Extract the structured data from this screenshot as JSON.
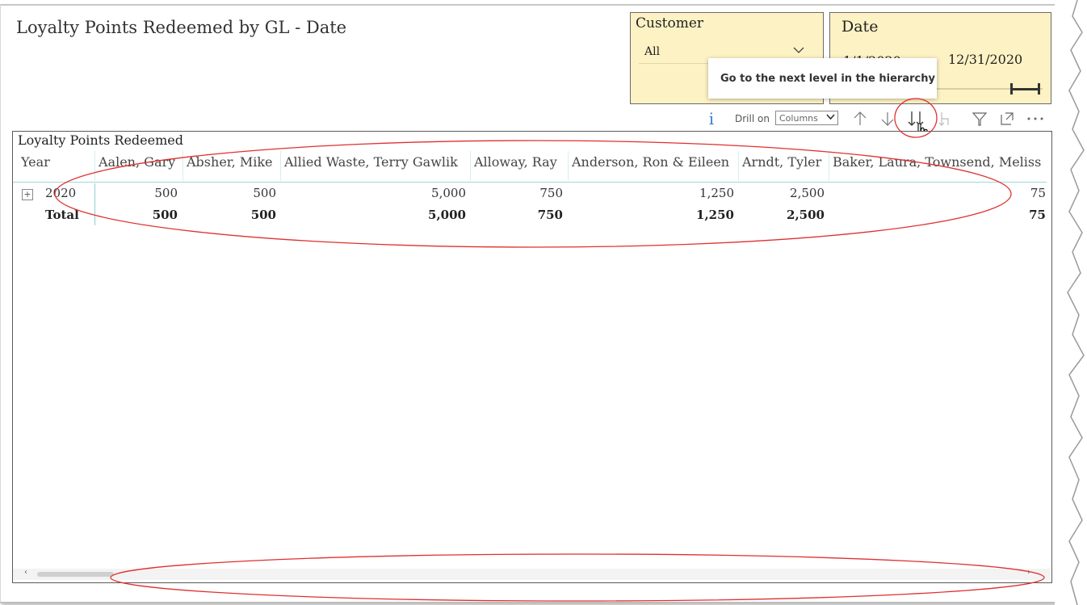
{
  "report": {
    "title": "Loyalty Points Redeemed by GL - Date"
  },
  "customer_slicer": {
    "title": "Customer",
    "selected": "All"
  },
  "date_slicer": {
    "title": "Date",
    "start": "1/1/2020",
    "end": "12/31/2020"
  },
  "tooltip": {
    "text": "Go to the next level in the hierarchy"
  },
  "toolbar": {
    "info_glyph": "i",
    "drill_on_label": "Drill on",
    "drill_on_value": "Columns",
    "icons": [
      "drill-up-icon",
      "drill-down-icon",
      "expand-next-level-icon",
      "expand-hierarchy-icon",
      "filter-icon",
      "focus-mode-icon",
      "more-options-icon"
    ]
  },
  "matrix": {
    "title": "Loyalty Points Redeemed",
    "row_header": "Year",
    "columns": [
      "Aalen, Gary",
      "Absher, Mike",
      "Allied Waste, Terry Gawlik",
      "Alloway, Ray",
      "Anderson, Ron & Eileen",
      "Arndt, Tyler",
      "Baker, Laura, Townsend, Meliss"
    ],
    "rows": [
      {
        "label": "2020",
        "values": [
          "500",
          "500",
          "5,000",
          "750",
          "1,250",
          "2,500",
          "75"
        ]
      }
    ],
    "total": {
      "label": "Total",
      "values": [
        "500",
        "500",
        "5,000",
        "750",
        "1,250",
        "2,500",
        "75"
      ]
    }
  },
  "colors": {
    "slicer_bg": "#fdf2c4",
    "annotation": "#e03030",
    "grid_accent": "#8fd3ce"
  }
}
